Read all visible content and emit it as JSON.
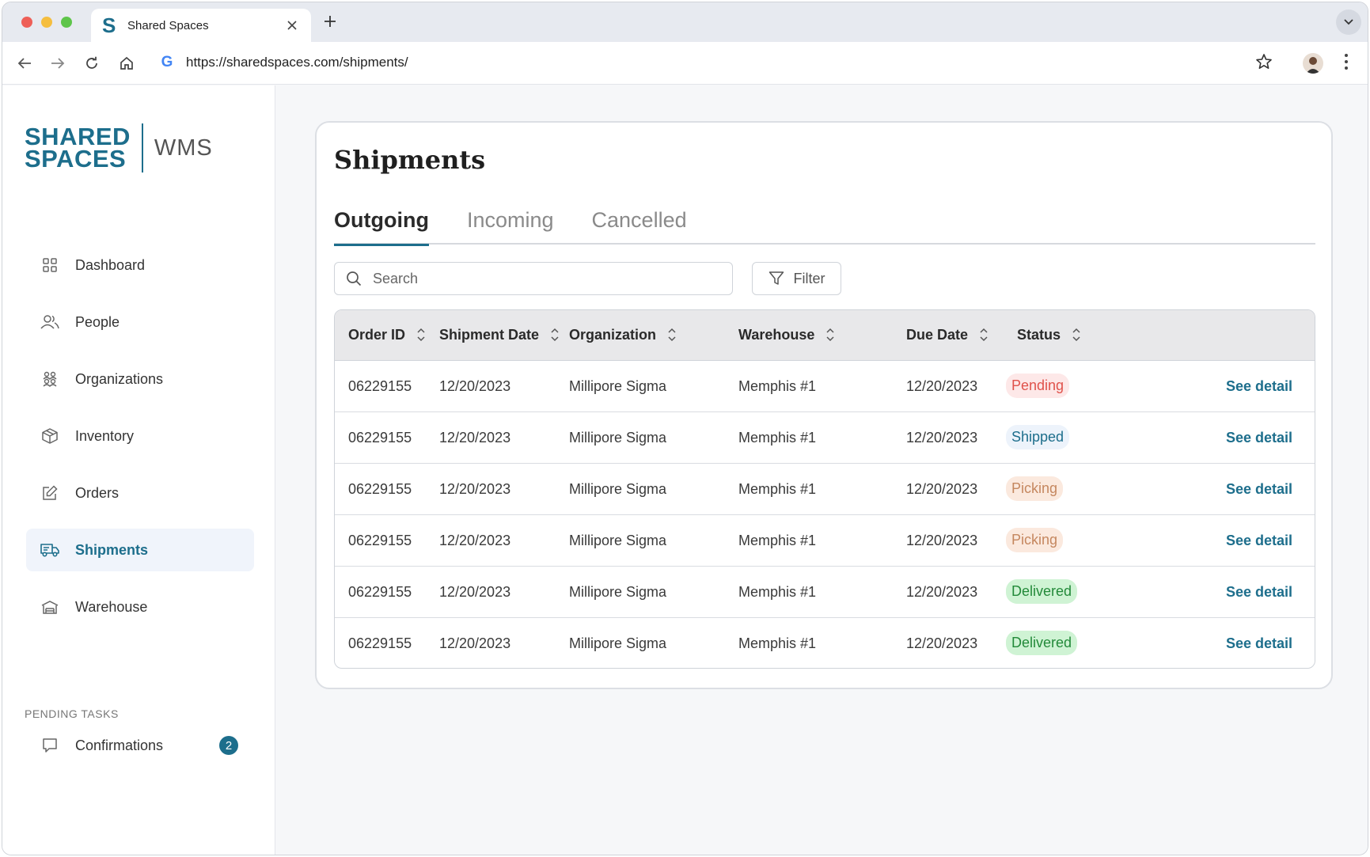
{
  "browser": {
    "tab_title": "Shared Spaces",
    "tab_favicon": "S",
    "url": "https://sharedspaces.com/shipments/",
    "url_icon": "G"
  },
  "logo": {
    "line1": "SHARED",
    "line2": "SPACES",
    "product": "WMS"
  },
  "sidebar": {
    "items": [
      {
        "label": "Dashboard",
        "icon": "dashboard-grid-icon"
      },
      {
        "label": "People",
        "icon": "people-icon"
      },
      {
        "label": "Organizations",
        "icon": "organizations-icon"
      },
      {
        "label": "Inventory",
        "icon": "box-icon"
      },
      {
        "label": "Orders",
        "icon": "edit-icon"
      },
      {
        "label": "Shipments",
        "icon": "truck-icon",
        "active": true
      },
      {
        "label": "Warehouse",
        "icon": "warehouse-icon"
      }
    ],
    "pending_title": "PENDING TASKS",
    "pending_items": [
      {
        "label": "Confirmations",
        "icon": "confirmation-icon",
        "badge": "2"
      }
    ]
  },
  "main": {
    "title": "Shipments",
    "tabs": [
      {
        "label": "Outgoing",
        "active": true
      },
      {
        "label": "Incoming"
      },
      {
        "label": "Cancelled"
      }
    ],
    "search_placeholder": "Search",
    "filter_label": "Filter",
    "columns": [
      "Order ID",
      "Shipment Date",
      "Organization",
      "Warehouse",
      "Due Date",
      "Status"
    ],
    "detail_label": "See detail",
    "rows": [
      {
        "order_id": "06229155",
        "shipment_date": "12/20/2023",
        "organization": "Millipore Sigma",
        "warehouse": "Memphis #1",
        "due_date": "12/20/2023",
        "status": "Pending"
      },
      {
        "order_id": "06229155",
        "shipment_date": "12/20/2023",
        "organization": "Millipore Sigma",
        "warehouse": "Memphis #1",
        "due_date": "12/20/2023",
        "status": "Shipped"
      },
      {
        "order_id": "06229155",
        "shipment_date": "12/20/2023",
        "organization": "Millipore Sigma",
        "warehouse": "Memphis #1",
        "due_date": "12/20/2023",
        "status": "Picking"
      },
      {
        "order_id": "06229155",
        "shipment_date": "12/20/2023",
        "organization": "Millipore Sigma",
        "warehouse": "Memphis #1",
        "due_date": "12/20/2023",
        "status": "Picking"
      },
      {
        "order_id": "06229155",
        "shipment_date": "12/20/2023",
        "organization": "Millipore Sigma",
        "warehouse": "Memphis #1",
        "due_date": "12/20/2023",
        "status": "Delivered"
      },
      {
        "order_id": "06229155",
        "shipment_date": "12/20/2023",
        "organization": "Millipore Sigma",
        "warehouse": "Memphis #1",
        "due_date": "12/20/2023",
        "status": "Delivered"
      }
    ]
  },
  "colors": {
    "brand": "#1d6e8c",
    "pending": "#e0524b",
    "picking": "#c5875f",
    "delivered": "#238a3a"
  }
}
